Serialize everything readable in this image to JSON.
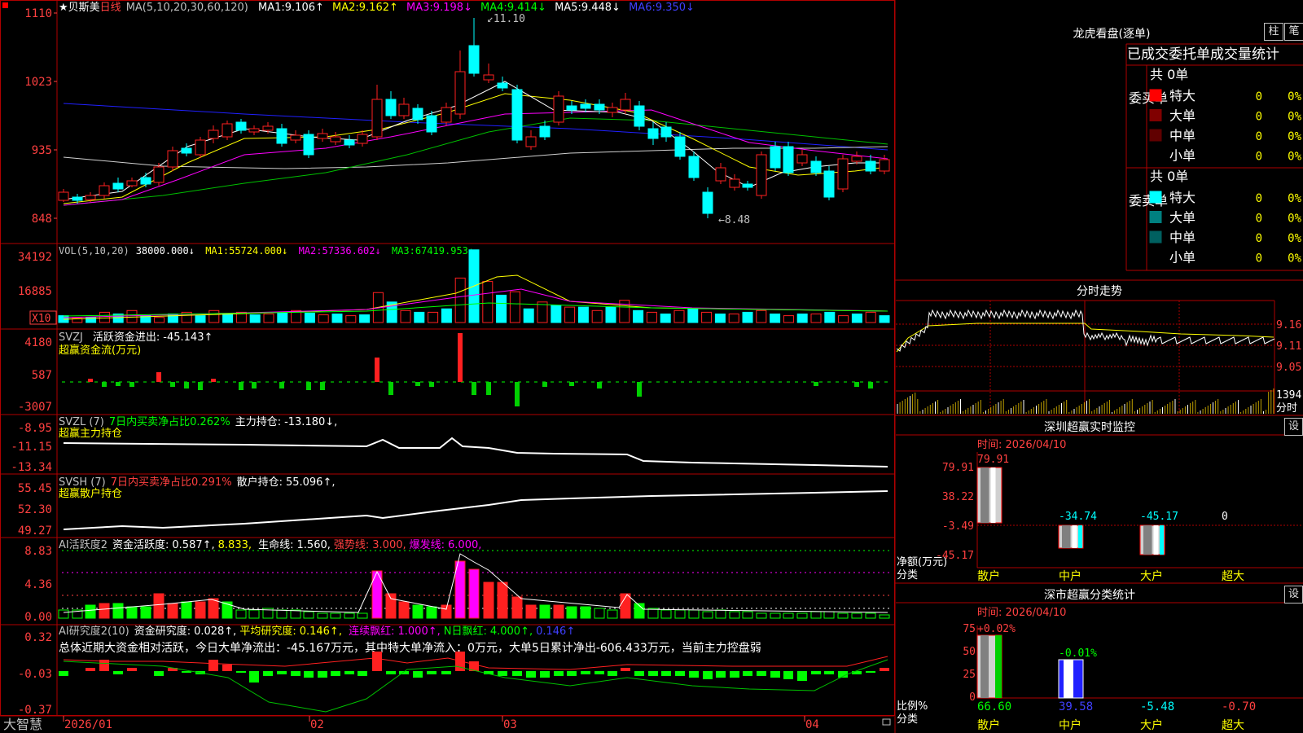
{
  "colors": {
    "up": "#ff2020",
    "down": "#00ffff",
    "border": "#b00000",
    "white": "#ffffff",
    "yellow": "#ffff00",
    "magenta": "#ff00ff",
    "green": "#00ff00",
    "blue": "#4040ff",
    "red_text": "#ff4040",
    "axis_text": "#ff4040",
    "grey": "#c0c0c0"
  },
  "header": {
    "star": "★",
    "stock_name": "贝斯美",
    "period": "日线",
    "ma_title": "MA(5,10,20,30,60,120)",
    "ma": [
      {
        "label": "MA1:",
        "value": "9.106↑",
        "color": "#ffffff"
      },
      {
        "label": "MA2:",
        "value": "9.162↑",
        "color": "#ffff00"
      },
      {
        "label": "MA3:",
        "value": "9.198↓",
        "color": "#ff00ff"
      },
      {
        "label": "MA4:",
        "value": "9.414↓",
        "color": "#00ff00"
      },
      {
        "label": "MA5:",
        "value": "9.448↓",
        "color": "#ffffff"
      },
      {
        "label": "MA6:",
        "value": "9.350↓",
        "color": "#4040ff"
      }
    ]
  },
  "price_axis": [
    "1110",
    "1023",
    "935",
    "848"
  ],
  "price_annotations": {
    "high": "11.10",
    "low": "8.48"
  },
  "vol": {
    "title": "VOL(5,10,20)",
    "value": "38000.000↓",
    "ma": [
      {
        "label": "MA1:",
        "value": "55724.000↓",
        "color": "#ffff00"
      },
      {
        "label": "MA2:",
        "value": "57336.602↓",
        "color": "#ff00ff"
      },
      {
        "label": "MA3:",
        "value": "67419.953↓",
        "color": "#00ff00"
      }
    ],
    "axis": [
      "34192",
      "16885"
    ],
    "unit": "X10"
  },
  "svzj": {
    "title": "SVZJ",
    "label": "活跃资金进出:",
    "value": "-45.143↑",
    "subtitle": "超赢资金流(万元)",
    "axis": [
      "4180",
      "587",
      "-3007"
    ]
  },
  "svzl": {
    "title": "SVZL (7)",
    "ratio": "7日内买卖净占比0.262%",
    "label": "主力持仓:",
    "value": "-13.180↓,",
    "subtitle": "超赢主力持仓",
    "axis": [
      "-8.95",
      "-11.15",
      "-13.34"
    ]
  },
  "svsh": {
    "title": "SVSH (7)",
    "ratio": "7日内买卖净占比0.291%",
    "label": "散户持仓:",
    "value": "55.096↑,",
    "subtitle": "超赢散户持仓",
    "axis": [
      "55.45",
      "52.30",
      "49.27"
    ]
  },
  "ai1": {
    "title": "AI活跃度2",
    "label": "资金活跃度:",
    "value": "0.587↑,",
    "v2": "8.833,",
    "life": "生命线:",
    "life_v": "1.560,",
    "strong": "强势线:",
    "strong_v": "3.000,",
    "burst": "爆发线:",
    "burst_v": "6.000,",
    "axis": [
      "8.83",
      "4.36",
      "0.00"
    ]
  },
  "ai2": {
    "title": "AI研究度2(10)",
    "label": "资金研究度:",
    "value": "0.028↑,",
    "avg": "平均研究度:",
    "avg_v": "0.146↑,",
    "cont": "连续飘红:",
    "cont_v": "1.000↑,",
    "nday": "N日飘红:",
    "nday_v": "4.000↑,",
    "last": "0.146↑",
    "summary": "总体近期大资金相对活跃，今日大单净流出：-45.167万元，其中特大单净流入：0万元，大单5日累计净出-606.433万元，当前主力控盘弱",
    "axis": [
      "0.32",
      "-0.03",
      "-0.37"
    ]
  },
  "dates": [
    "2026/01",
    "02",
    "03",
    "04"
  ],
  "brand": "大智慧",
  "lhb": {
    "title": "龙虎看盘(逐单)",
    "btn1": "柱",
    "btn2": "笔",
    "header": "已成交委托单成交量统计",
    "buy": {
      "side": "委买单",
      "count": "共 0单",
      "rows": [
        {
          "name": "特大",
          "v": "0",
          "p": "0%",
          "c": "#ff0000"
        },
        {
          "name": "大单",
          "v": "0",
          "p": "0%",
          "c": "#800000"
        },
        {
          "name": "中单",
          "v": "0",
          "p": "0%",
          "c": "#600000"
        },
        {
          "name": "小单",
          "v": "0",
          "p": "0%",
          "c": "#000000"
        }
      ]
    },
    "sell": {
      "side": "委卖单",
      "count": "共 0单",
      "rows": [
        {
          "name": "特大",
          "v": "0",
          "p": "0%",
          "c": "#00ffff"
        },
        {
          "name": "大单",
          "v": "0",
          "p": "0%",
          "c": "#008080"
        },
        {
          "name": "中单",
          "v": "0",
          "p": "0%",
          "c": "#006060"
        },
        {
          "name": "小单",
          "v": "0",
          "p": "0%",
          "c": "#000000"
        }
      ]
    }
  },
  "fenshi": {
    "title": "分时走势",
    "axis": [
      "9.16",
      "9.11",
      "9.05"
    ],
    "vol_label": "1394",
    "vol_unit": "分时"
  },
  "sz_monitor": {
    "title": "深圳超赢实时监控",
    "set": "设",
    "time": "时间: 2026/04/10",
    "axis": [
      "79.91",
      "38.22",
      "-3.49",
      "-45.17"
    ],
    "ylabel": "净额(万元)",
    "xlabel": "分类",
    "cats": [
      "散户",
      "中户",
      "大户",
      "超大"
    ],
    "values": [
      "79.91",
      "-34.74",
      "-45.17",
      "0"
    ]
  },
  "sz_class": {
    "title": "深市超赢分类统计",
    "set": "设",
    "time": "时间: 2026/04/10",
    "axis": [
      "75",
      "50",
      "25",
      "0"
    ],
    "ylabel": "比例%",
    "xlabel": "分类",
    "cats": [
      "散户",
      "中户",
      "大户",
      "超大"
    ],
    "top": [
      "+0.02%",
      "-0.01%",
      "",
      ""
    ],
    "values": [
      "66.60",
      "39.58",
      "-5.48",
      "-0.70"
    ]
  }
}
